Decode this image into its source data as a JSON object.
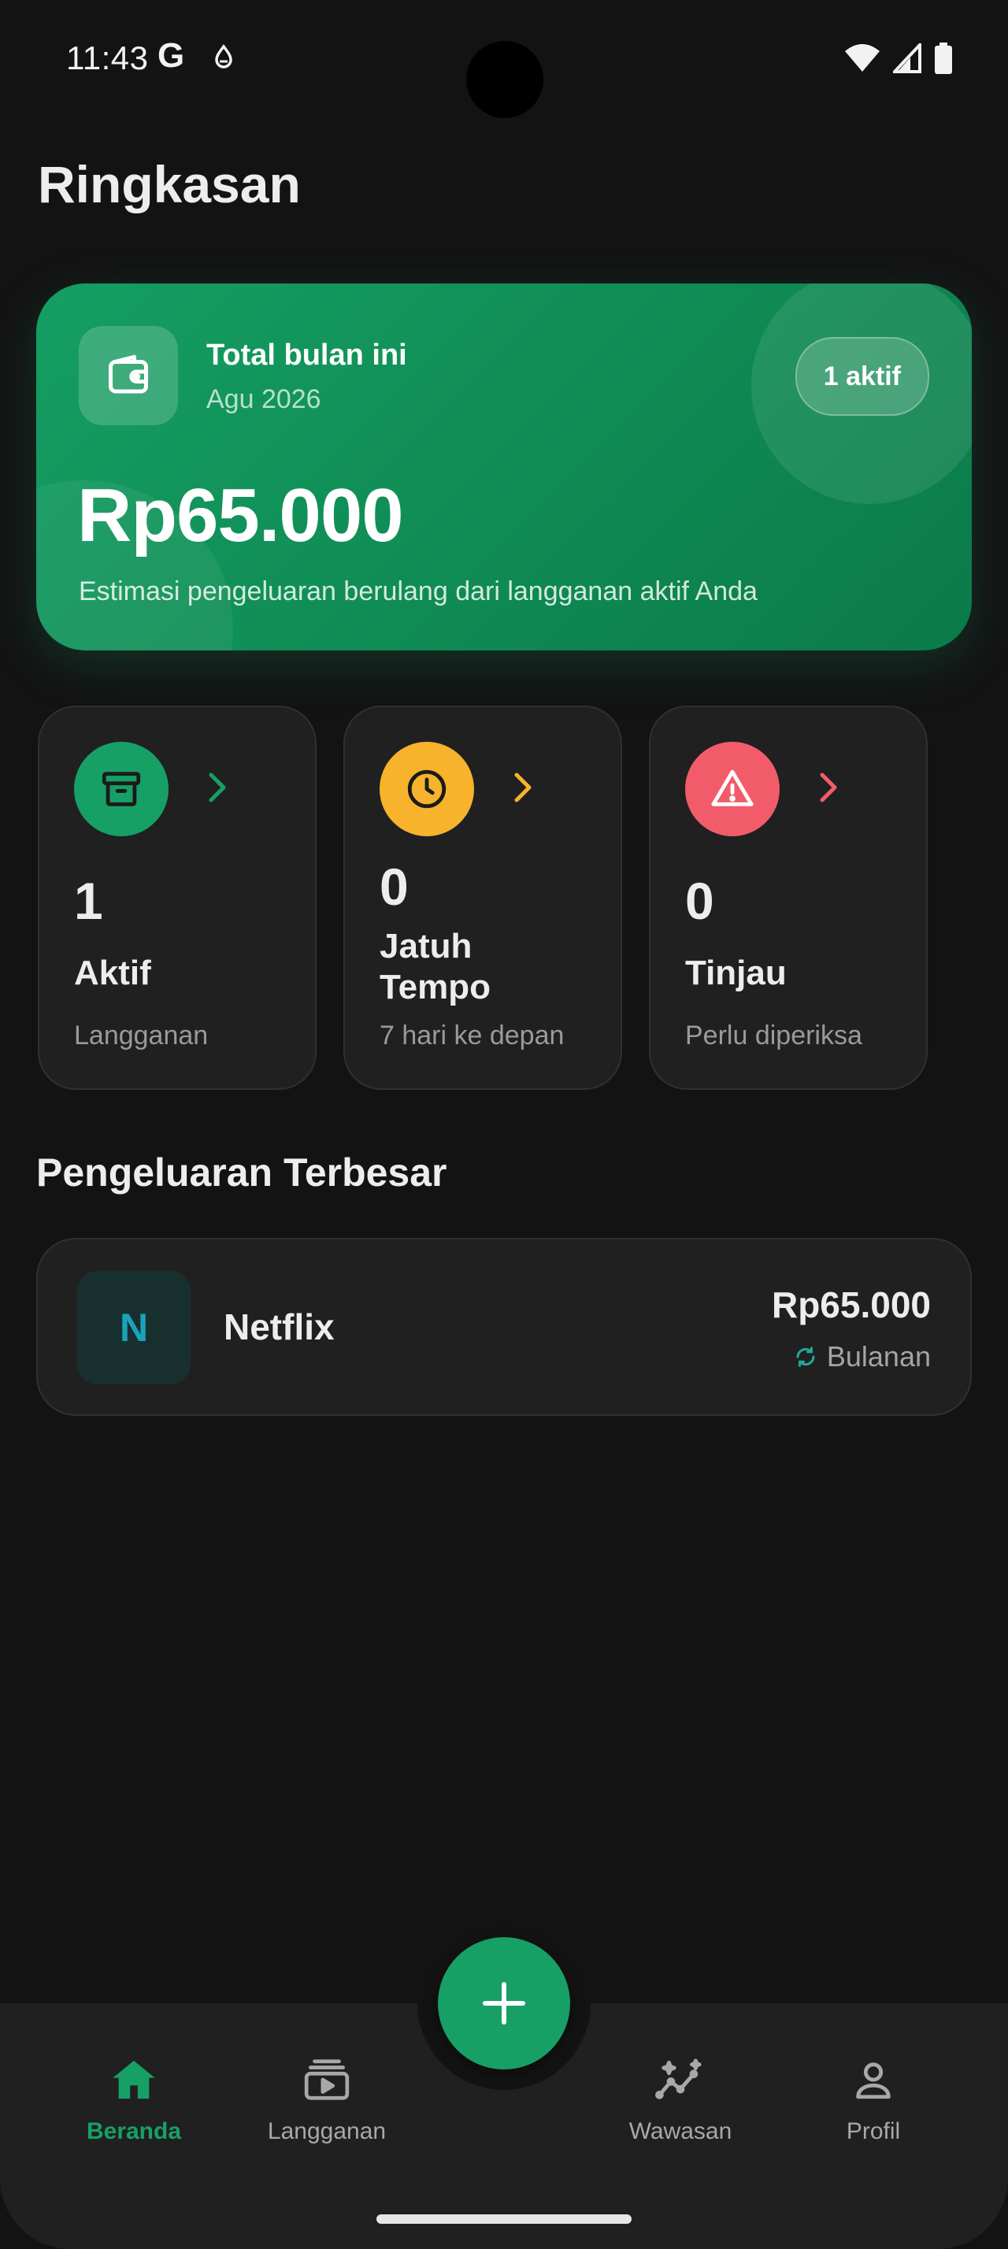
{
  "status_bar": {
    "time": "11:43",
    "google_glyph": "G"
  },
  "page": {
    "title": "Ringkasan"
  },
  "summary": {
    "title": "Total bulan ini",
    "period": "Agu 2026",
    "badge": "1 aktif",
    "amount": "Rp65.000",
    "description": "Estimasi pengeluaran berulang dari langganan aktif Anda",
    "accent": "#139b5f"
  },
  "stats": [
    {
      "count": "1",
      "label": "Aktif",
      "sub": "Langganan",
      "color": "#16a066",
      "icon": "archive-icon"
    },
    {
      "count": "0",
      "label": "Jatuh Tempo",
      "sub": "7 hari ke depan",
      "color": "#f7b32b",
      "icon": "clock-icon"
    },
    {
      "count": "0",
      "label": "Tinjau",
      "sub": "Perlu diperiksa",
      "color": "#f25c6a",
      "icon": "warning-icon"
    }
  ],
  "section": {
    "title": "Pengeluaran Terbesar"
  },
  "top_expense": {
    "initial": "N",
    "name": "Netflix",
    "price": "Rp65.000",
    "cycle": "Bulanan"
  },
  "nav": {
    "items": [
      {
        "label": "Beranda",
        "icon": "home-icon",
        "active": true
      },
      {
        "label": "Langganan",
        "icon": "subscriptions-icon",
        "active": false
      },
      {
        "label": "Wawasan",
        "icon": "insights-icon",
        "active": false
      },
      {
        "label": "Profil",
        "icon": "profile-icon",
        "active": false
      }
    ],
    "fab_icon": "plus-icon",
    "accent": "#16a066"
  }
}
